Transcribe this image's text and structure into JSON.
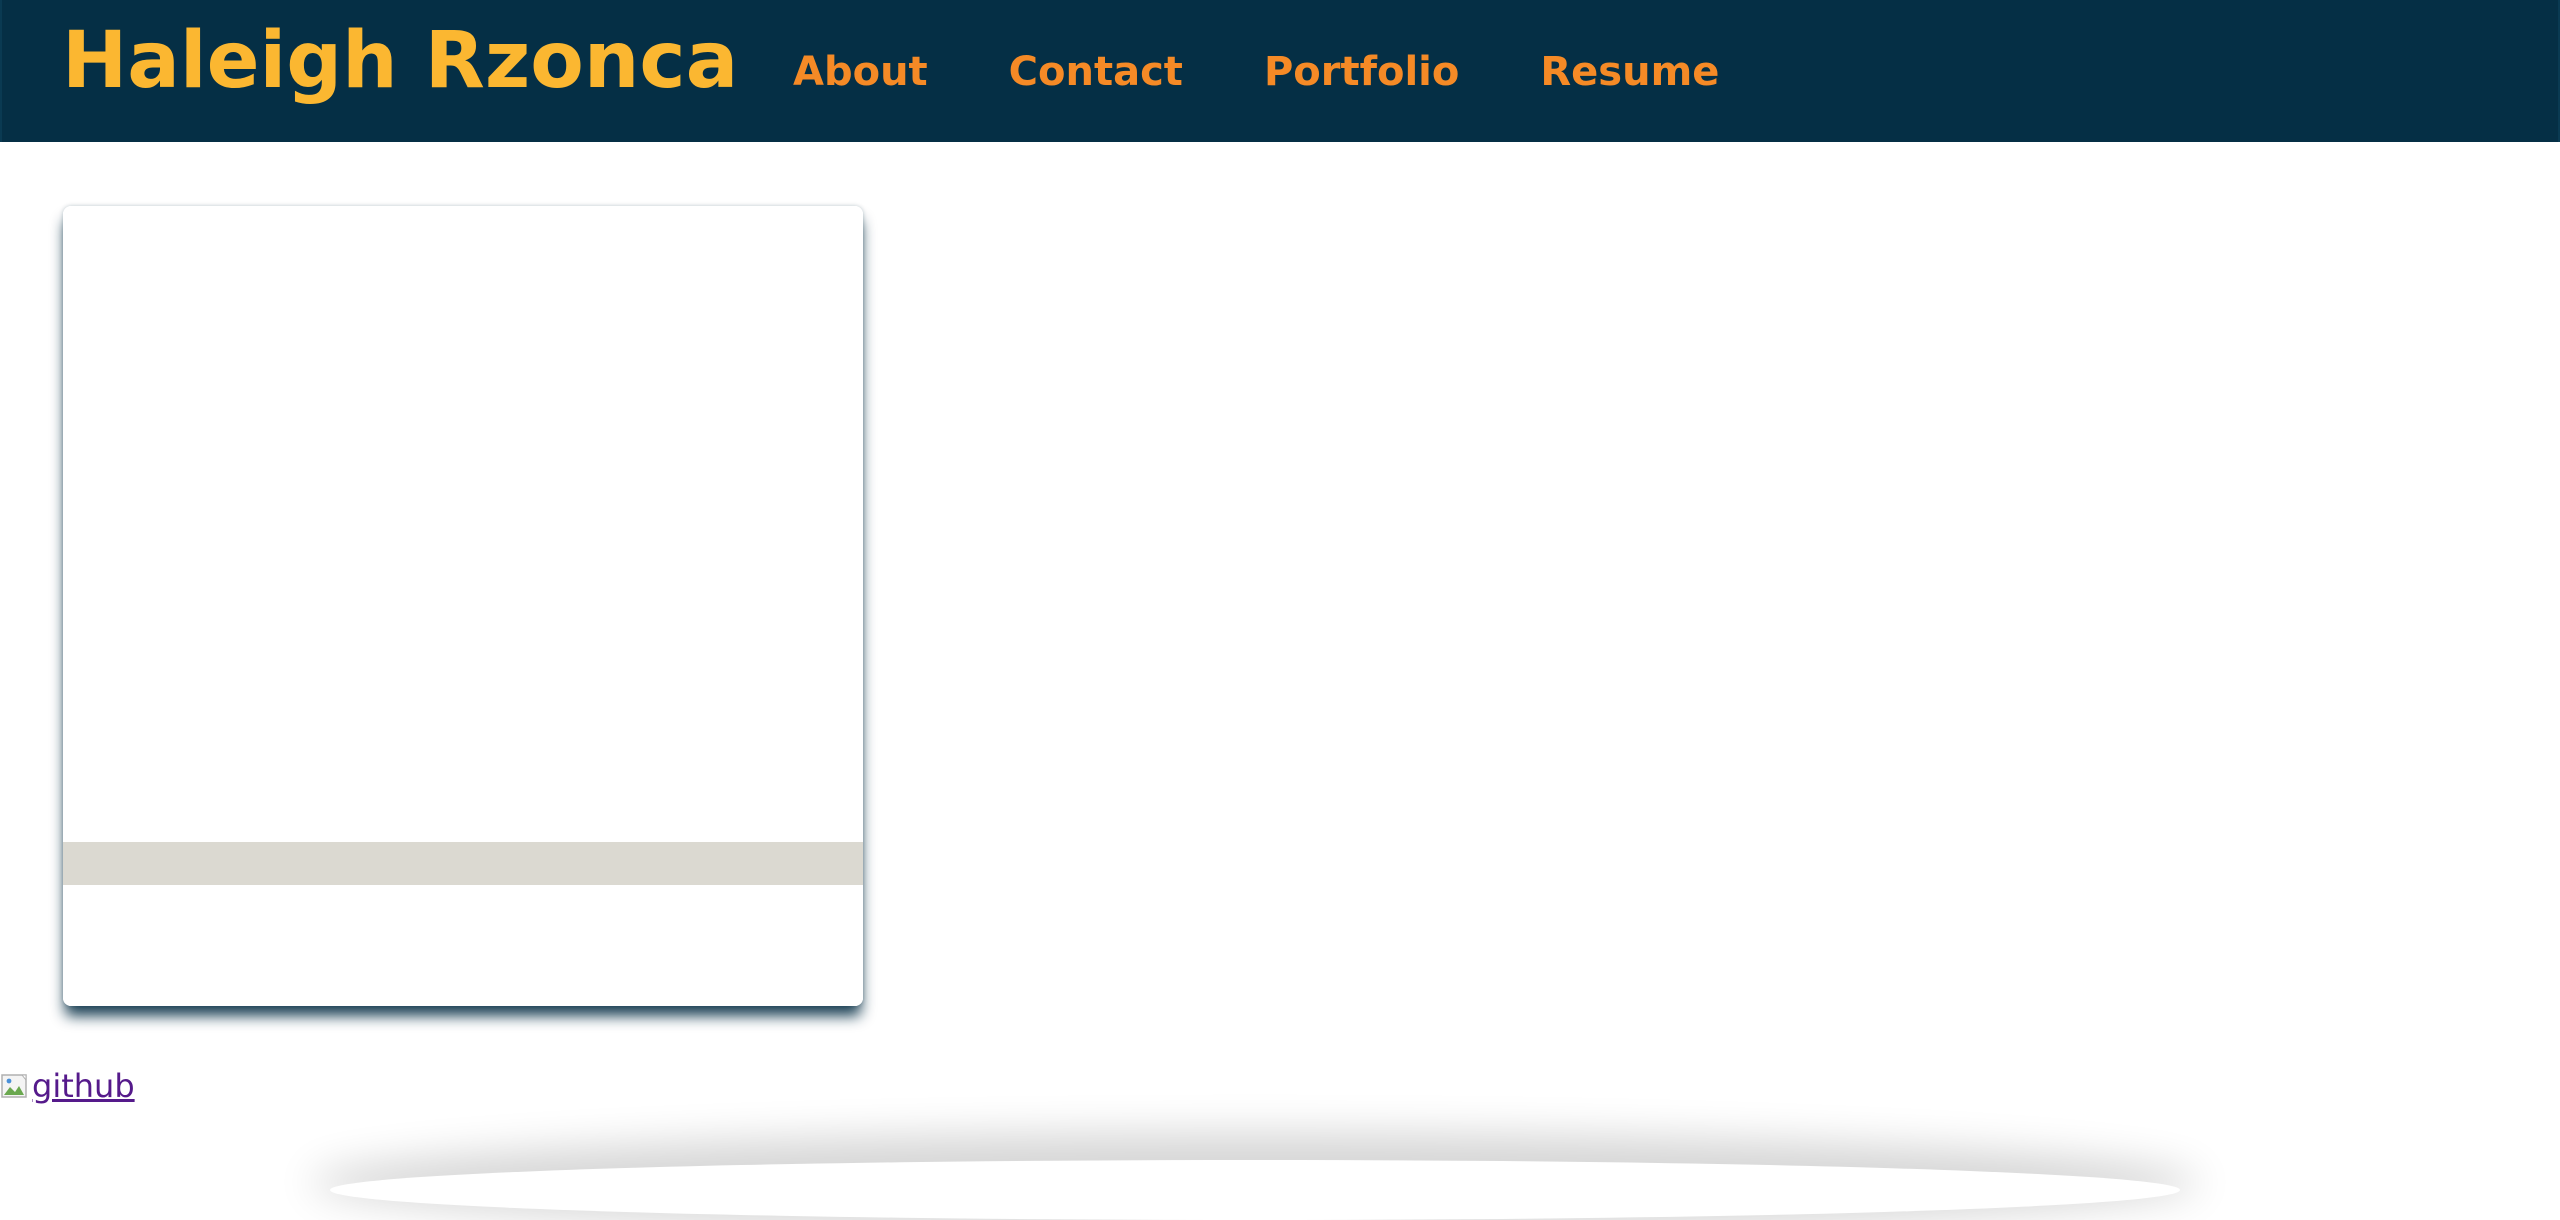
{
  "header": {
    "brand": "Haleigh Rzonca",
    "nav": [
      {
        "label": "About"
      },
      {
        "label": "Contact"
      },
      {
        "label": "Portfolio"
      },
      {
        "label": "Resume"
      }
    ]
  },
  "card": {
    "image": "",
    "caption": ""
  },
  "github_link": {
    "alt_text": "github",
    "icon": "broken-image-icon"
  },
  "colors": {
    "header_bg": "#052f45",
    "brand": "#fbb731",
    "nav": "#f58a26",
    "card_band": "#dbd9d1",
    "link": "#551a8b"
  }
}
